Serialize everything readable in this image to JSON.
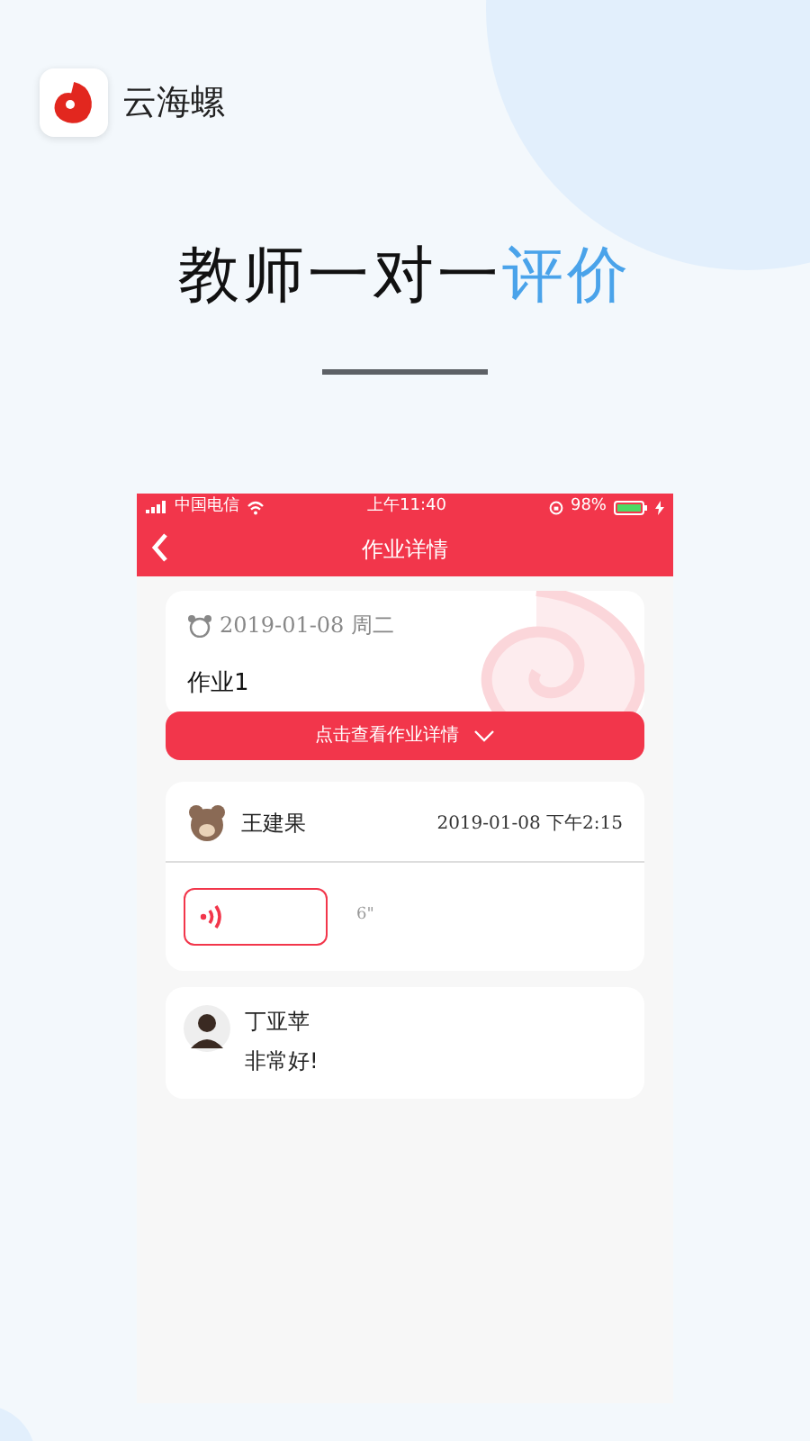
{
  "app": {
    "name": "云海螺"
  },
  "headline": [
    {
      "text": "教师一对一",
      "accent": false
    },
    {
      "text": "评价",
      "accent": true
    }
  ],
  "phone": {
    "status_bar": {
      "carrier": "中国电信",
      "time": "上午11:40",
      "battery": "98%"
    },
    "nav": {
      "title": "作业详情"
    },
    "homework": {
      "date": "2019-01-08 周二",
      "title": "作业1",
      "button": "点击查看作业详情"
    },
    "submission": {
      "student": "王建果",
      "time": "2019-01-08 下午2:15",
      "duration": "6\""
    },
    "comment": {
      "teacher": "丁亚苹",
      "text": "非常好!"
    }
  }
}
